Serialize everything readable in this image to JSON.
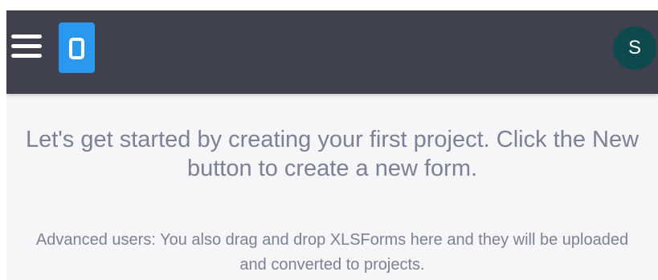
{
  "header": {
    "menu_icon": "hamburger-menu-icon",
    "logo_icon": "app-logo-icon",
    "avatar_initial": "S",
    "background_color": "#3f414f",
    "logo_color": "#2a98ee",
    "avatar_color": "#0e4a4d"
  },
  "main": {
    "headline": "Let's get started by creating your first project. Click the New button to create a new form.",
    "subtext": "Advanced users: You also drag and drop XLSForms here and they will be uploaded and converted to projects."
  }
}
